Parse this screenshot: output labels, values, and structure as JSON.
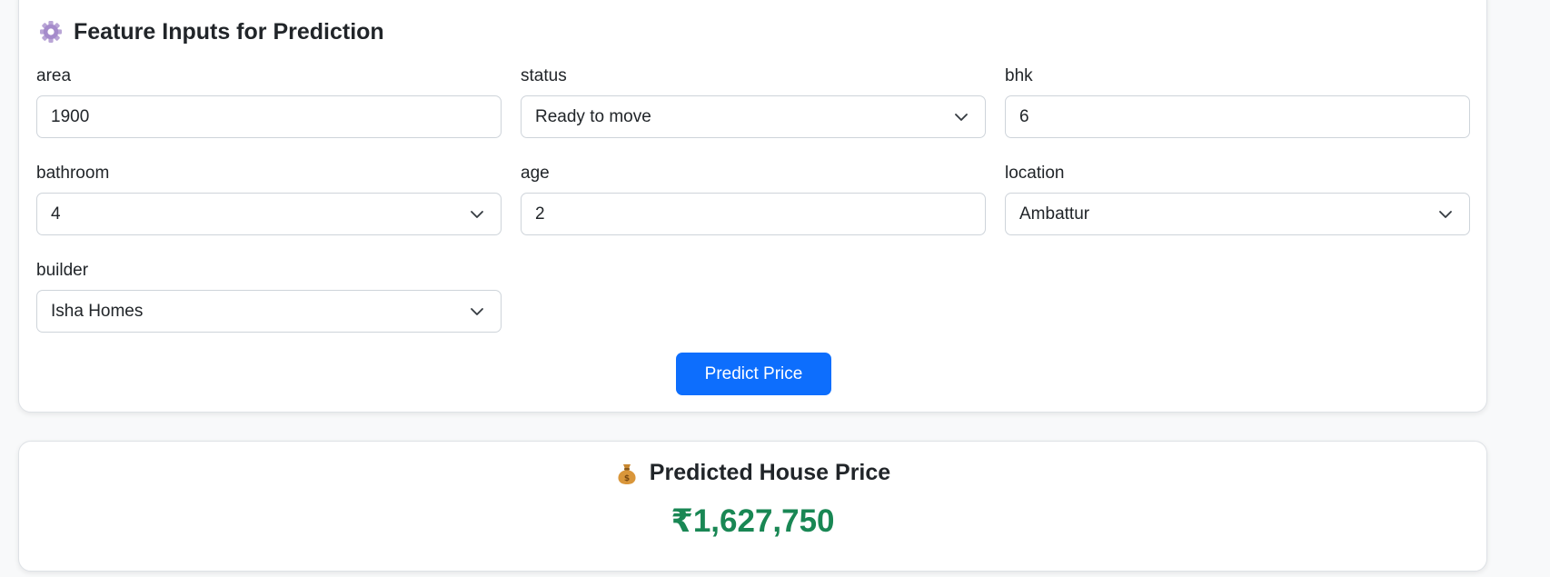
{
  "colors": {
    "primary": "#0d6efd",
    "success": "#198754",
    "border": "#ced4da",
    "card_border": "#dee2e6",
    "text": "#212529"
  },
  "inputs_card": {
    "icon": "gear-icon",
    "title": "Feature Inputs for Prediction",
    "fields": [
      {
        "label": "area",
        "type": "number",
        "value": "1900"
      },
      {
        "label": "status",
        "type": "select",
        "value": "Ready to move"
      },
      {
        "label": "bhk",
        "type": "number",
        "value": "6"
      },
      {
        "label": "bathroom",
        "type": "select",
        "value": "4"
      },
      {
        "label": "age",
        "type": "number",
        "value": "2"
      },
      {
        "label": "location",
        "type": "select",
        "value": "Ambattur"
      },
      {
        "label": "builder",
        "type": "select",
        "value": "Isha Homes"
      }
    ],
    "submit_label": "Predict Price"
  },
  "result_card": {
    "icon": "money-bag-icon",
    "title": "Predicted House Price",
    "value": "₹1,627,750"
  }
}
